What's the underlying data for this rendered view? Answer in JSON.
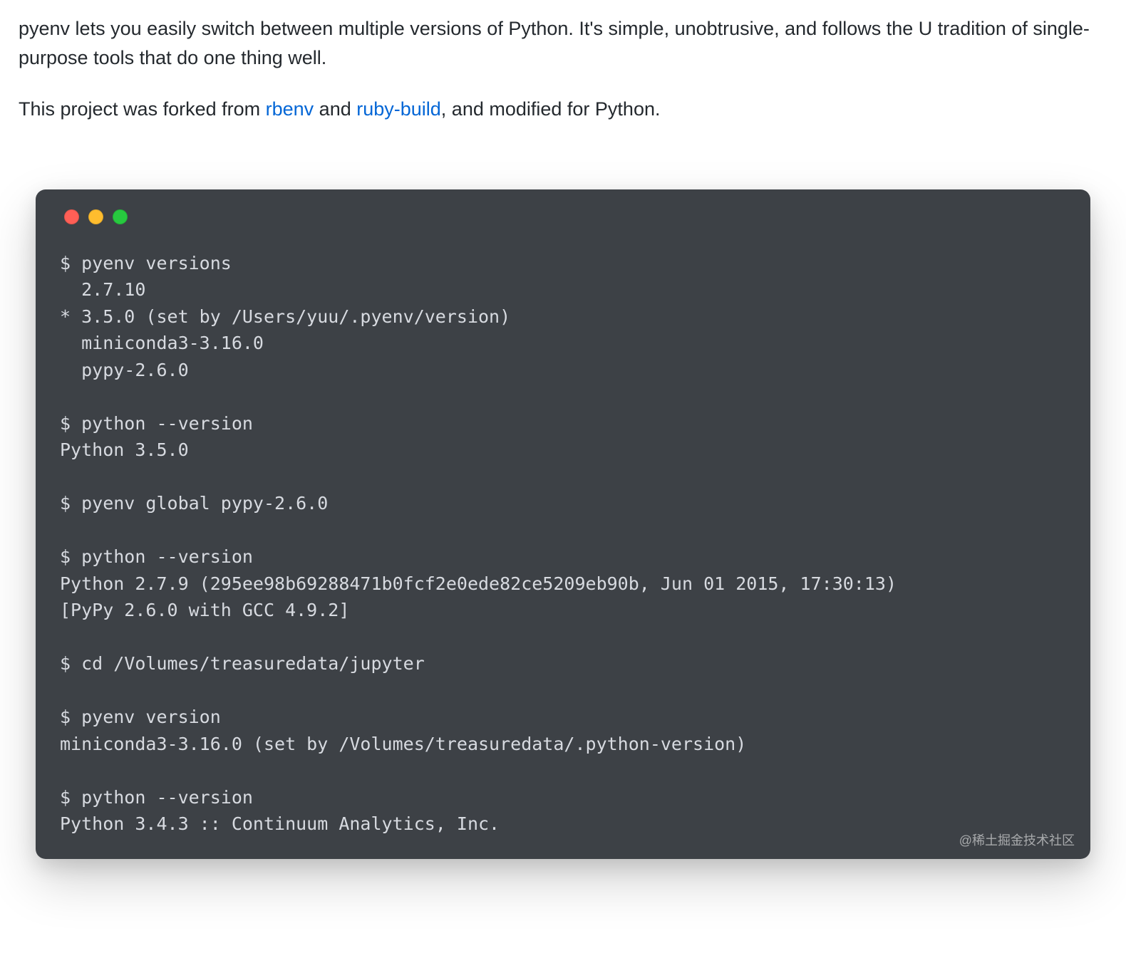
{
  "intro": {
    "p1": "pyenv lets you easily switch between multiple versions of Python. It's simple, unobtrusive, and follows the U tradition of single-purpose tools that do one thing well.",
    "p2_pre": "This project was forked from ",
    "p2_link1": "rbenv",
    "p2_mid": " and ",
    "p2_link2": "ruby-build",
    "p2_post": ", and modified for Python."
  },
  "terminal": {
    "lines": "$ pyenv versions\n  2.7.10\n* 3.5.0 (set by /Users/yuu/.pyenv/version)\n  miniconda3-3.16.0\n  pypy-2.6.0\n\n$ python --version\nPython 3.5.0\n\n$ pyenv global pypy-2.6.0\n\n$ python --version\nPython 2.7.9 (295ee98b69288471b0fcf2e0ede82ce5209eb90b, Jun 01 2015, 17:30:13)\n[PyPy 2.6.0 with GCC 4.9.2]\n\n$ cd /Volumes/treasuredata/jupyter\n\n$ pyenv version\nminiconda3-3.16.0 (set by /Volumes/treasuredata/.python-version)\n\n$ python --version\nPython 3.4.3 :: Continuum Analytics, Inc."
  },
  "watermark": "@稀土掘金技术社区"
}
